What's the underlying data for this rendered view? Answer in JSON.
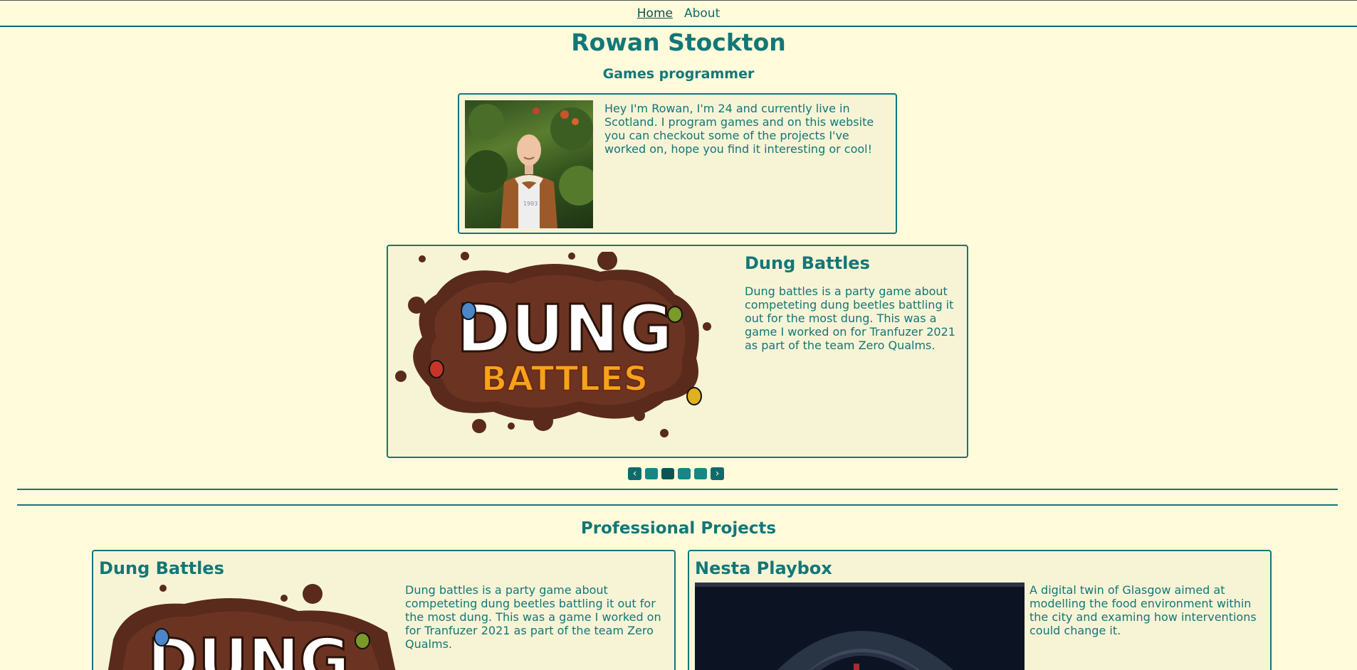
{
  "nav": {
    "items": [
      {
        "label": "Home",
        "active": true
      },
      {
        "label": "About",
        "active": false
      }
    ]
  },
  "header": {
    "title": "Rowan Stockton",
    "subtitle": "Games programmer"
  },
  "bio": {
    "text": "Hey I'm Rowan, I'm 24 and currently live in Scotland. I program games and on this website you can checkout some of the projects I've worked on, hope you find it interesting or cool!",
    "photo_shirt_text": "1993"
  },
  "carousel": {
    "title": "Dung Battles",
    "description": "Dung battles is a party game about competeting dung beetles battling it out for the most dung. This was a game I worked on for Tranfuzer 2021 as part of the team Zero Qualms.",
    "prev_icon": "chevron-left-icon",
    "next_icon": "chevron-right-icon",
    "prev_label": "‹",
    "next_label": "›",
    "dot_count": 4,
    "active_dot": 1,
    "logo": {
      "line1": "DUNG",
      "line2": "BATTLES"
    }
  },
  "projects": {
    "heading": "Professional Projects",
    "items": [
      {
        "title": "Dung Battles",
        "description": "Dung battles is a party game about competeting dung beetles battling it out for the most dung. This was a game I worked on for Tranfuzer 2021 as part of the team Zero Qualms.",
        "logo_text": "DUNG"
      },
      {
        "title": "Nesta Playbox",
        "description": "A digital twin of Glasgow aimed at modelling the food environment within the city and examing how interventions could change it."
      }
    ]
  },
  "colors": {
    "background": "#fffbdb",
    "accent": "#137777",
    "card_background": "#f7f4d6",
    "dung_brown": "#5a2a1c",
    "battles_orange": "#f7a21b"
  }
}
